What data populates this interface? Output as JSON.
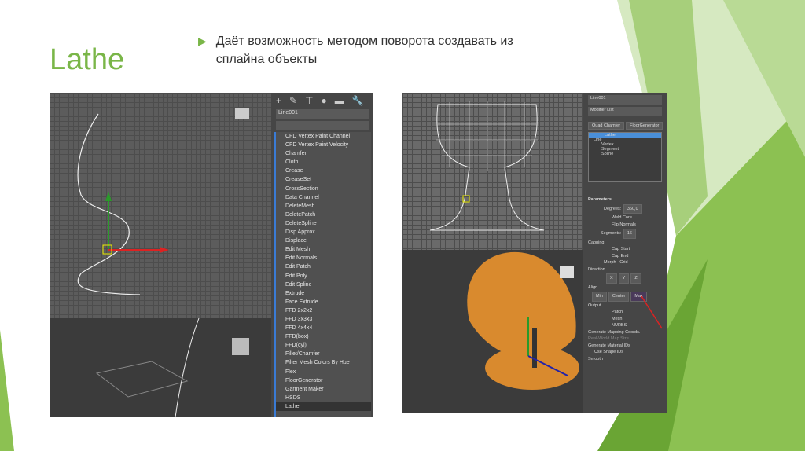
{
  "slide": {
    "title": "Lathe",
    "bullet": "Даёт возможность методом поворота создавать из сплайна объекты"
  },
  "colors": {
    "accent": "#7ab648"
  },
  "left_shot": {
    "object_name": "Line001",
    "modifiers": [
      "CFD Vertex Paint Channel",
      "CFD Vertex Paint Velocity",
      "Chamfer",
      "Cloth",
      "Crease",
      "CreaseSet",
      "CrossSection",
      "Data Channel",
      "DeleteMesh",
      "DeletePatch",
      "DeleteSpline",
      "Disp Approx",
      "Displace",
      "Edit Mesh",
      "Edit Normals",
      "Edit Patch",
      "Edit Poly",
      "Edit Spline",
      "Extrude",
      "Face Extrude",
      "FFD 2x2x2",
      "FFD 3x3x3",
      "FFD 4x4x4",
      "FFD(box)",
      "FFD(cyl)",
      "Fillet/Chamfer",
      "Filter Mesh Colors By Hue",
      "Flex",
      "FloorGenerator",
      "Garment Maker",
      "HSDS",
      "Lathe"
    ],
    "selected": "Lathe"
  },
  "right_shot": {
    "object_name": "Line001",
    "modifier_list": "Modifier List",
    "buttons": [
      "Quad Chamfer",
      "FloorGenerator"
    ],
    "stack": [
      "Lathe",
      "Line",
      "Vertex",
      "Segment",
      "Spline"
    ],
    "parameters": {
      "header": "Parameters",
      "degrees_label": "Degrees:",
      "degrees": "360,0",
      "weld_core": "Weld Core",
      "flip_normals": "Flip Normals",
      "segments_label": "Segments:",
      "segments": "16",
      "capping": "Capping",
      "cap_start": "Cap Start",
      "cap_end": "Cap End",
      "morph": "Morph",
      "grid": "Grid",
      "direction": "Direction",
      "dir": [
        "X",
        "Y",
        "Z"
      ],
      "align": "Align",
      "align_btns": [
        "Min",
        "Center",
        "Max"
      ],
      "output": "Output",
      "out": [
        "Patch",
        "Mesh",
        "NURBS"
      ],
      "gen_mapping": "Generate Mapping Coords.",
      "real_world": "Real-World Map Size",
      "gen_material": "Generate Material IDs",
      "use_shape": "Use Shape IDs",
      "smooth": "Smooth"
    }
  }
}
